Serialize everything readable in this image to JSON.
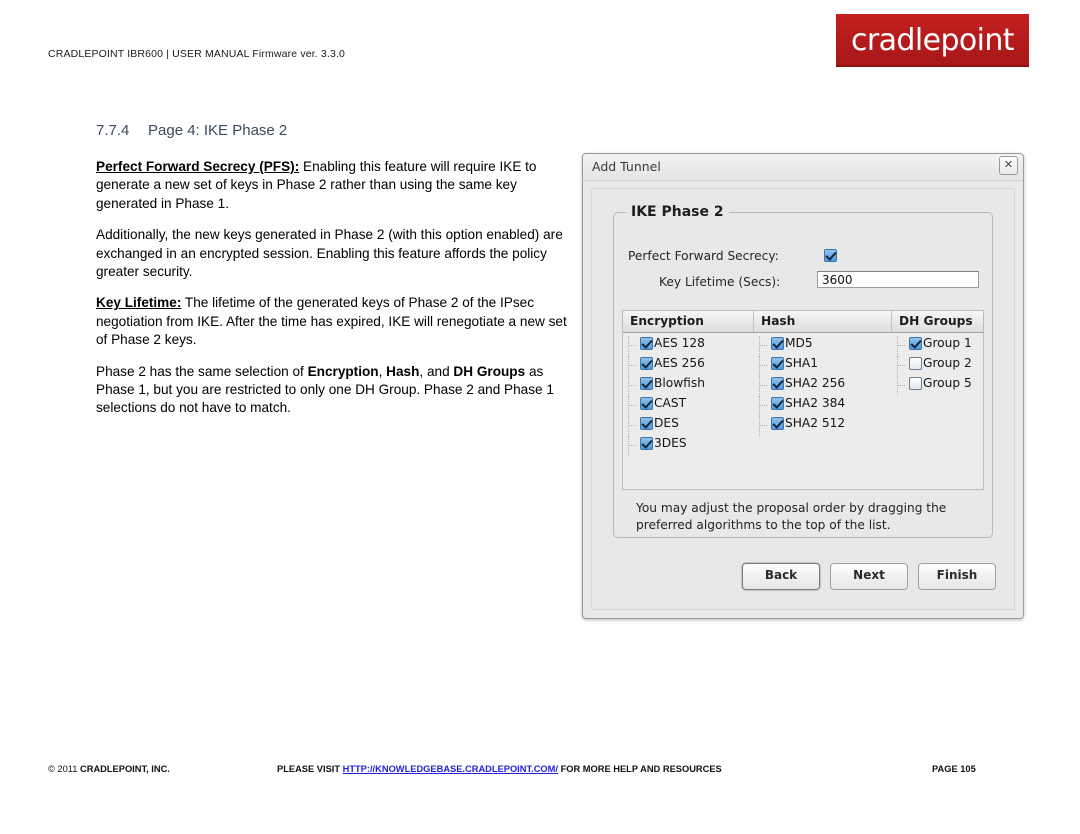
{
  "header": {
    "manual_line": "CRADLEPOINT IBR600 | USER MANUAL Firmware ver. 3.3.0",
    "logo_text": "cradlepoint",
    "logo_color": "#c2191c"
  },
  "section": {
    "number": "7.7.4",
    "title": "Page 4: IKE Phase 2",
    "title_color": "#3b4a5c"
  },
  "body": {
    "p1_term": "Perfect Forward Secrecy (PFS):",
    "p1_text": " Enabling this feature will require IKE to generate a new set of keys in Phase 2 rather than using the same key generated in Phase 1.",
    "p2_text": "Additionally, the new keys generated in Phase 2 (with this option enabled) are exchanged in an encrypted session. Enabling this feature affords the policy greater security.",
    "p3_term": "Key Lifetime:",
    "p3_text": " The lifetime of the generated keys of Phase 2 of the IPsec negotiation from IKE. After the time has expired, IKE will renegotiate a new set of Phase 2 keys.",
    "p4_a": "Phase 2 has the same selection of ",
    "p4_b1": "Encryption",
    "p4_c": ", ",
    "p4_b2": "Hash",
    "p4_d": ", and ",
    "p4_b3": "DH Groups",
    "p4_e": " as Phase 1, but you are restricted to only one DH Group. Phase 2 and Phase 1 selections do not have to match."
  },
  "dialog": {
    "title": "Add Tunnel",
    "close_icon": "✕",
    "fieldset_legend": "IKE Phase 2",
    "pfs_label": "Perfect Forward Secrecy:",
    "pfs_checked": true,
    "key_lifetime_label": "Key Lifetime (Secs):",
    "key_lifetime_value": "3600",
    "table": {
      "headers": [
        "Encryption",
        "Hash",
        "DH Groups"
      ],
      "encryption": [
        {
          "label": "AES 128",
          "checked": true
        },
        {
          "label": "AES 256",
          "checked": true
        },
        {
          "label": "Blowfish",
          "checked": true
        },
        {
          "label": "CAST",
          "checked": true
        },
        {
          "label": "DES",
          "checked": true
        },
        {
          "label": "3DES",
          "checked": true
        }
      ],
      "hash": [
        {
          "label": "MD5",
          "checked": true
        },
        {
          "label": "SHA1",
          "checked": true
        },
        {
          "label": "SHA2 256",
          "checked": true
        },
        {
          "label": "SHA2 384",
          "checked": true
        },
        {
          "label": "SHA2 512",
          "checked": true
        }
      ],
      "dh_groups": [
        {
          "label": "Group 1",
          "checked": true
        },
        {
          "label": "Group 2",
          "checked": false
        },
        {
          "label": "Group 5",
          "checked": false
        }
      ]
    },
    "note": "You may adjust the proposal order by dragging the preferred algorithms to the top of the list.",
    "buttons": {
      "back": "Back",
      "next": "Next",
      "finish": "Finish"
    }
  },
  "footer": {
    "copyright_symbol": "© 2011 ",
    "copyright_company": "CRADLEPOINT, INC.",
    "please_visit": "PLEASE VISIT ",
    "link": "HTTP://KNOWLEDGEBASE.CRADLEPOINT.COM/",
    "tail": " FOR MORE HELP AND RESOURCES",
    "page": "PAGE 105"
  }
}
